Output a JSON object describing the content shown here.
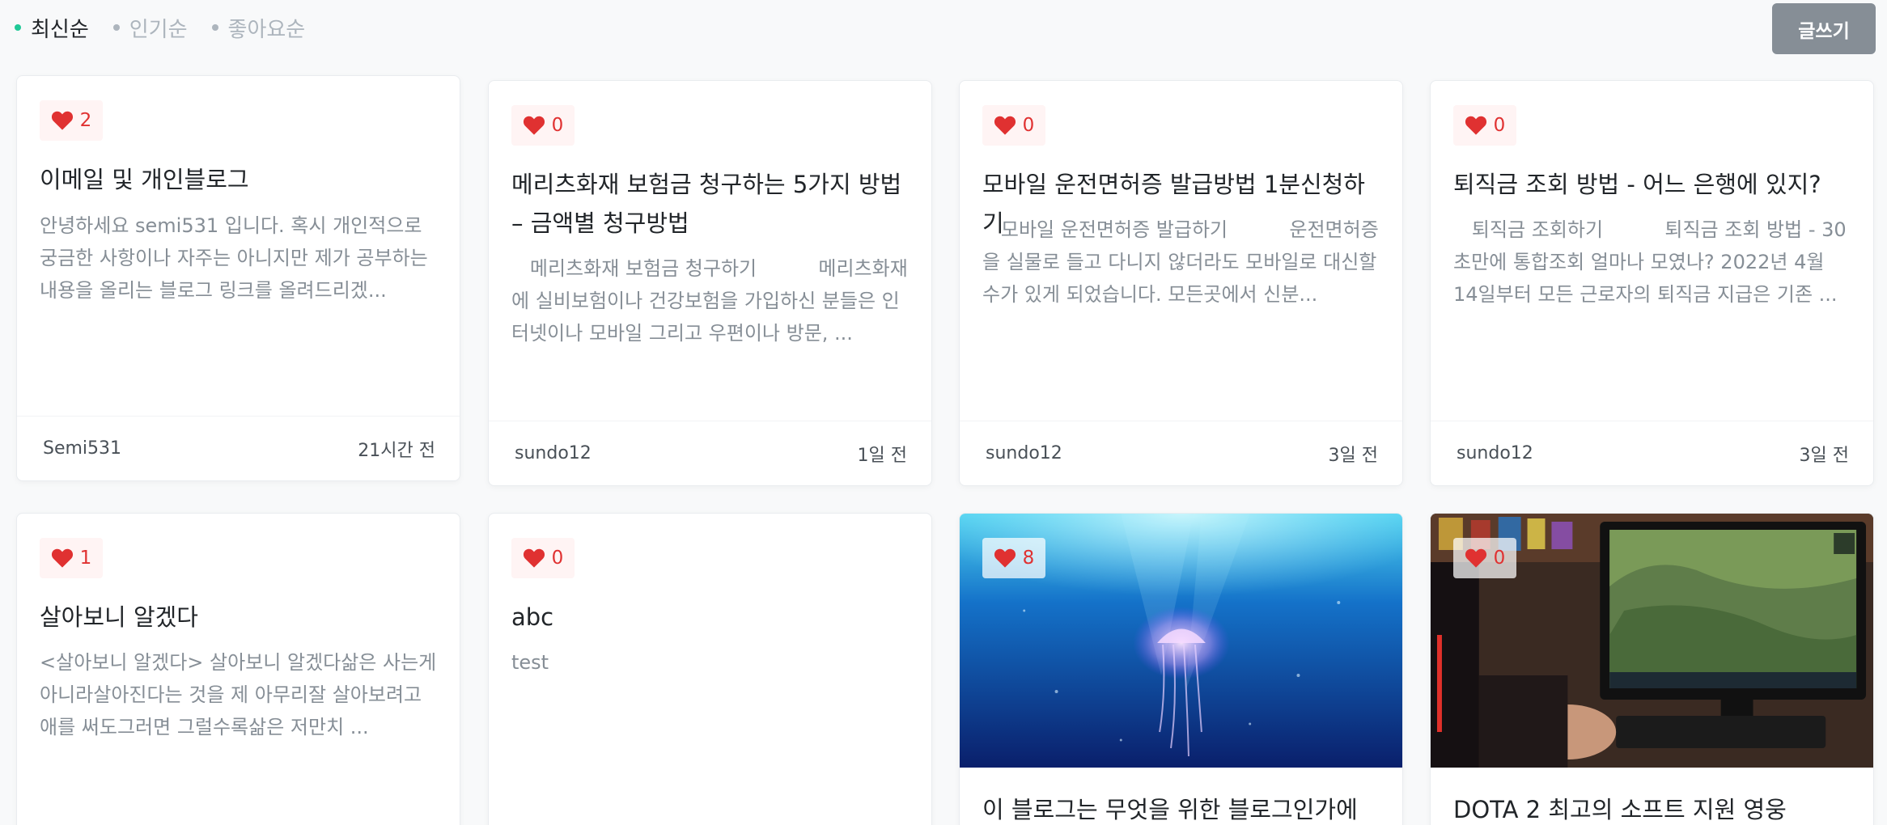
{
  "sort": {
    "latest": "최신순",
    "popular": "인기순",
    "liked": "좋아요순"
  },
  "write_button": "글쓰기",
  "posts": [
    {
      "likes": "2",
      "title": "이메일 및 개인블로그",
      "excerpt": "안녕하세요 semi531 입니다. 혹시 개인적으로 궁금한 사항이나 자주는 아니지만 제가 공부하는 내용을 올리는 블로그 링크를 올려드리겠...",
      "author": "Semi531",
      "date": "21시간 전"
    },
    {
      "likes": "0",
      "title": "메리츠화재 보험금 청구하는 5가지 방법 – 금액별 청구방법",
      "excerpt": "   메리츠화재 보험금 청구하기          메리츠화재에 실비보험이나 건강보험을 가입하신 분들은 인터넷이나 모바일 그리고 우편이나 방문, ...",
      "author": "sundo12",
      "date": "1일 전"
    },
    {
      "likes": "0",
      "title": "모바일 운전면허증 발급방법 1분신청하기",
      "excerpt": "   모바일 운전면허증 발급하기          운전면허증을 실물로 들고 다니지 않더라도 모바일로 대신할 수가 있게 되었습니다. 모든곳에서 신분...",
      "author": "sundo12",
      "date": "3일 전"
    },
    {
      "likes": "0",
      "title": "퇴직금 조회 방법 - 어느 은행에 있지?",
      "excerpt": "   퇴직금 조회하기          퇴직금 조회 방법 - 30초만에 통합조회 얼마나 모였나? 2022년 4월 14일부터 모든 근로자의 퇴직금 지급은 기존 ...",
      "author": "sundo12",
      "date": "3일 전"
    },
    {
      "likes": "1",
      "title": "살아보니 알겠다",
      "excerpt": "<살아보니 알겠다> 살아보니 알겠다삶은 사는게 아니라살아진다는 것을 제 아무리잘 살아보려고 애를 써도그러면 그럴수록삶은 저만치 ...",
      "author": "",
      "date": ""
    },
    {
      "likes": "0",
      "title": "abc",
      "excerpt": "test",
      "author": "",
      "date": ""
    },
    {
      "likes": "8",
      "title": "이 블로그는 무엇을 위한 블로그인가에",
      "excerpt": "",
      "author": "",
      "date": "",
      "thumbnail": "underwater-jellyfish"
    },
    {
      "likes": "0",
      "title": "DOTA 2 최고의 소프트 지원 영웅",
      "excerpt": "",
      "author": "",
      "date": "",
      "thumbnail": "gaming-monitor"
    }
  ],
  "colors": {
    "accent": "#20c997",
    "heart": "#e03131",
    "button": "#868e96"
  }
}
